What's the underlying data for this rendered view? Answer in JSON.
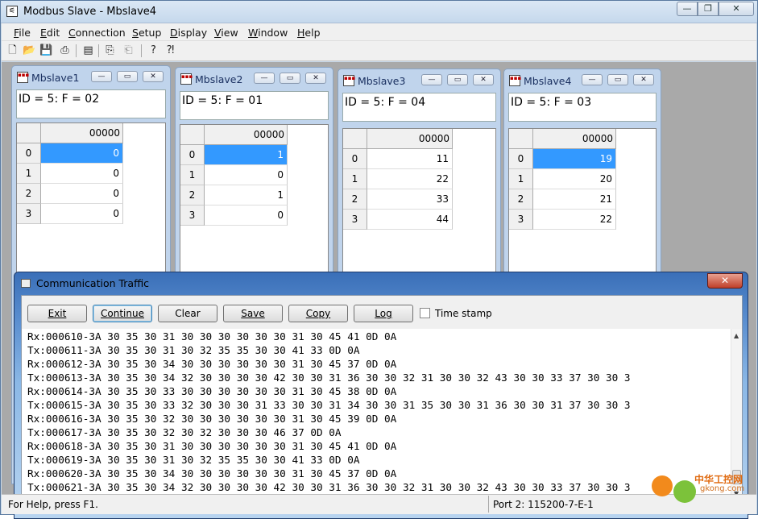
{
  "app": {
    "title": "Modbus Slave - Mbslave4",
    "icon": "modbus-app-icon"
  },
  "menu": [
    {
      "label": "File",
      "ul": 0
    },
    {
      "label": "Edit",
      "ul": 0
    },
    {
      "label": "Connection",
      "ul": 0
    },
    {
      "label": "Setup",
      "ul": 0
    },
    {
      "label": "Display",
      "ul": 0
    },
    {
      "label": "View",
      "ul": 0
    },
    {
      "label": "Window",
      "ul": 0
    },
    {
      "label": "Help",
      "ul": 0
    }
  ],
  "toolbar": {
    "icons": [
      "new-document-icon",
      "open-folder-icon",
      "save-disk-icon",
      "print-icon",
      "window-icon",
      "connect-icon",
      "disconnect-icon",
      "help-icon",
      "context-help-icon"
    ]
  },
  "children": [
    {
      "title": "Mbslave1",
      "id": "ID = 5: F = 02",
      "col": "00000",
      "rows": [
        "0",
        "1",
        "2",
        "3"
      ],
      "values": [
        "0",
        "0",
        "0",
        "0"
      ],
      "selected": 0
    },
    {
      "title": "Mbslave2",
      "id": "ID = 5: F = 01",
      "col": "00000",
      "rows": [
        "0",
        "1",
        "2",
        "3"
      ],
      "values": [
        "1",
        "0",
        "1",
        "0"
      ],
      "selected": 0
    },
    {
      "title": "Mbslave3",
      "id": "ID = 5: F = 04",
      "col": "00000",
      "rows": [
        "0",
        "1",
        "2",
        "3"
      ],
      "values": [
        "11",
        "22",
        "33",
        "44"
      ],
      "selected": -1
    },
    {
      "title": "Mbslave4",
      "id": "ID = 5: F = 03",
      "col": "00000",
      "rows": [
        "0",
        "1",
        "2",
        "3"
      ],
      "values": [
        "19",
        "20",
        "21",
        "22"
      ],
      "selected": 0
    }
  ],
  "traffic": {
    "title": "Communication Traffic",
    "close": "✕",
    "buttons": {
      "exit": "Exit",
      "continue": "Continue",
      "clear": "Clear",
      "save": "Save",
      "copy": "Copy",
      "log": "Log"
    },
    "timestamp_label": "Time stamp",
    "timestamp_checked": false,
    "lines": [
      "Rx:000610-3A 30 35 30 31 30 30 30 30 30 30 31 30 45 41 0D 0A",
      "Tx:000611-3A 30 35 30 31 30 32 35 35 30 30 41 33 0D 0A",
      "Rx:000612-3A 30 35 30 34 30 30 30 30 30 30 31 30 45 37 0D 0A",
      "Tx:000613-3A 30 35 30 34 32 30 30 30 30 42 30 30 31 36 30 30 32 31 30 30 32 43 30 30 33 37 30 30 3",
      "Rx:000614-3A 30 35 30 33 30 30 30 30 30 30 31 30 45 38 0D 0A",
      "Tx:000615-3A 30 35 30 33 32 30 30 30 31 33 30 30 31 34 30 30 31 35 30 30 31 36 30 30 31 37 30 30 3",
      "Rx:000616-3A 30 35 30 32 30 30 30 30 30 30 31 30 45 39 0D 0A",
      "Tx:000617-3A 30 35 30 32 30 32 30 30 30 46 37 0D 0A",
      "Rx:000618-3A 30 35 30 31 30 30 30 30 30 30 31 30 45 41 0D 0A",
      "Tx:000619-3A 30 35 30 31 30 32 35 35 30 30 41 33 0D 0A",
      "Rx:000620-3A 30 35 30 34 30 30 30 30 30 30 31 30 45 37 0D 0A",
      "Tx:000621-3A 30 35 30 34 32 30 30 30 30 42 30 30 31 36 30 30 32 31 30 30 32 43 30 30 33 37 30 30 3"
    ]
  },
  "status": {
    "help": "For Help, press F1.",
    "port": "Port 2: 115200-7-E-1"
  },
  "watermark": {
    "text": "中华工控网",
    "sub": "gkong.com"
  }
}
